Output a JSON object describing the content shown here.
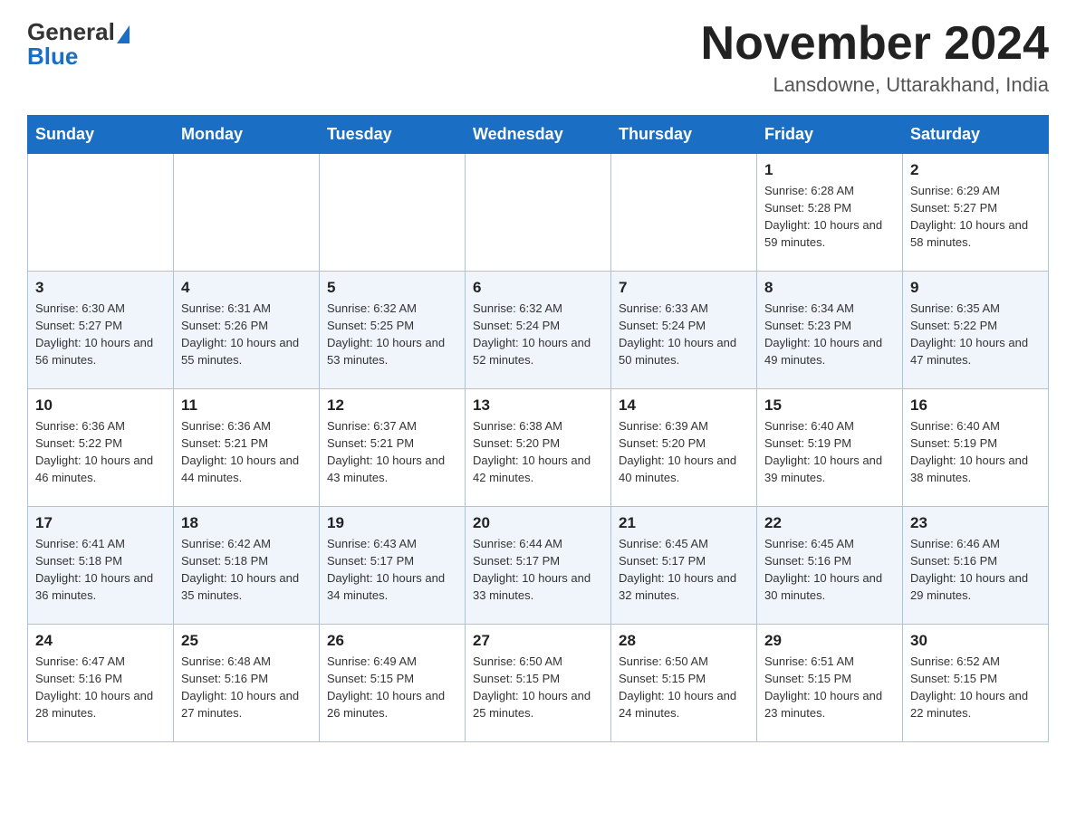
{
  "header": {
    "logo_general": "General",
    "logo_blue": "Blue",
    "month_title": "November 2024",
    "location": "Lansdowne, Uttarakhand, India"
  },
  "days_of_week": [
    "Sunday",
    "Monday",
    "Tuesday",
    "Wednesday",
    "Thursday",
    "Friday",
    "Saturday"
  ],
  "weeks": [
    [
      {
        "day": "",
        "info": ""
      },
      {
        "day": "",
        "info": ""
      },
      {
        "day": "",
        "info": ""
      },
      {
        "day": "",
        "info": ""
      },
      {
        "day": "",
        "info": ""
      },
      {
        "day": "1",
        "info": "Sunrise: 6:28 AM\nSunset: 5:28 PM\nDaylight: 10 hours and 59 minutes."
      },
      {
        "day": "2",
        "info": "Sunrise: 6:29 AM\nSunset: 5:27 PM\nDaylight: 10 hours and 58 minutes."
      }
    ],
    [
      {
        "day": "3",
        "info": "Sunrise: 6:30 AM\nSunset: 5:27 PM\nDaylight: 10 hours and 56 minutes."
      },
      {
        "day": "4",
        "info": "Sunrise: 6:31 AM\nSunset: 5:26 PM\nDaylight: 10 hours and 55 minutes."
      },
      {
        "day": "5",
        "info": "Sunrise: 6:32 AM\nSunset: 5:25 PM\nDaylight: 10 hours and 53 minutes."
      },
      {
        "day": "6",
        "info": "Sunrise: 6:32 AM\nSunset: 5:24 PM\nDaylight: 10 hours and 52 minutes."
      },
      {
        "day": "7",
        "info": "Sunrise: 6:33 AM\nSunset: 5:24 PM\nDaylight: 10 hours and 50 minutes."
      },
      {
        "day": "8",
        "info": "Sunrise: 6:34 AM\nSunset: 5:23 PM\nDaylight: 10 hours and 49 minutes."
      },
      {
        "day": "9",
        "info": "Sunrise: 6:35 AM\nSunset: 5:22 PM\nDaylight: 10 hours and 47 minutes."
      }
    ],
    [
      {
        "day": "10",
        "info": "Sunrise: 6:36 AM\nSunset: 5:22 PM\nDaylight: 10 hours and 46 minutes."
      },
      {
        "day": "11",
        "info": "Sunrise: 6:36 AM\nSunset: 5:21 PM\nDaylight: 10 hours and 44 minutes."
      },
      {
        "day": "12",
        "info": "Sunrise: 6:37 AM\nSunset: 5:21 PM\nDaylight: 10 hours and 43 minutes."
      },
      {
        "day": "13",
        "info": "Sunrise: 6:38 AM\nSunset: 5:20 PM\nDaylight: 10 hours and 42 minutes."
      },
      {
        "day": "14",
        "info": "Sunrise: 6:39 AM\nSunset: 5:20 PM\nDaylight: 10 hours and 40 minutes."
      },
      {
        "day": "15",
        "info": "Sunrise: 6:40 AM\nSunset: 5:19 PM\nDaylight: 10 hours and 39 minutes."
      },
      {
        "day": "16",
        "info": "Sunrise: 6:40 AM\nSunset: 5:19 PM\nDaylight: 10 hours and 38 minutes."
      }
    ],
    [
      {
        "day": "17",
        "info": "Sunrise: 6:41 AM\nSunset: 5:18 PM\nDaylight: 10 hours and 36 minutes."
      },
      {
        "day": "18",
        "info": "Sunrise: 6:42 AM\nSunset: 5:18 PM\nDaylight: 10 hours and 35 minutes."
      },
      {
        "day": "19",
        "info": "Sunrise: 6:43 AM\nSunset: 5:17 PM\nDaylight: 10 hours and 34 minutes."
      },
      {
        "day": "20",
        "info": "Sunrise: 6:44 AM\nSunset: 5:17 PM\nDaylight: 10 hours and 33 minutes."
      },
      {
        "day": "21",
        "info": "Sunrise: 6:45 AM\nSunset: 5:17 PM\nDaylight: 10 hours and 32 minutes."
      },
      {
        "day": "22",
        "info": "Sunrise: 6:45 AM\nSunset: 5:16 PM\nDaylight: 10 hours and 30 minutes."
      },
      {
        "day": "23",
        "info": "Sunrise: 6:46 AM\nSunset: 5:16 PM\nDaylight: 10 hours and 29 minutes."
      }
    ],
    [
      {
        "day": "24",
        "info": "Sunrise: 6:47 AM\nSunset: 5:16 PM\nDaylight: 10 hours and 28 minutes."
      },
      {
        "day": "25",
        "info": "Sunrise: 6:48 AM\nSunset: 5:16 PM\nDaylight: 10 hours and 27 minutes."
      },
      {
        "day": "26",
        "info": "Sunrise: 6:49 AM\nSunset: 5:15 PM\nDaylight: 10 hours and 26 minutes."
      },
      {
        "day": "27",
        "info": "Sunrise: 6:50 AM\nSunset: 5:15 PM\nDaylight: 10 hours and 25 minutes."
      },
      {
        "day": "28",
        "info": "Sunrise: 6:50 AM\nSunset: 5:15 PM\nDaylight: 10 hours and 24 minutes."
      },
      {
        "day": "29",
        "info": "Sunrise: 6:51 AM\nSunset: 5:15 PM\nDaylight: 10 hours and 23 minutes."
      },
      {
        "day": "30",
        "info": "Sunrise: 6:52 AM\nSunset: 5:15 PM\nDaylight: 10 hours and 22 minutes."
      }
    ]
  ]
}
